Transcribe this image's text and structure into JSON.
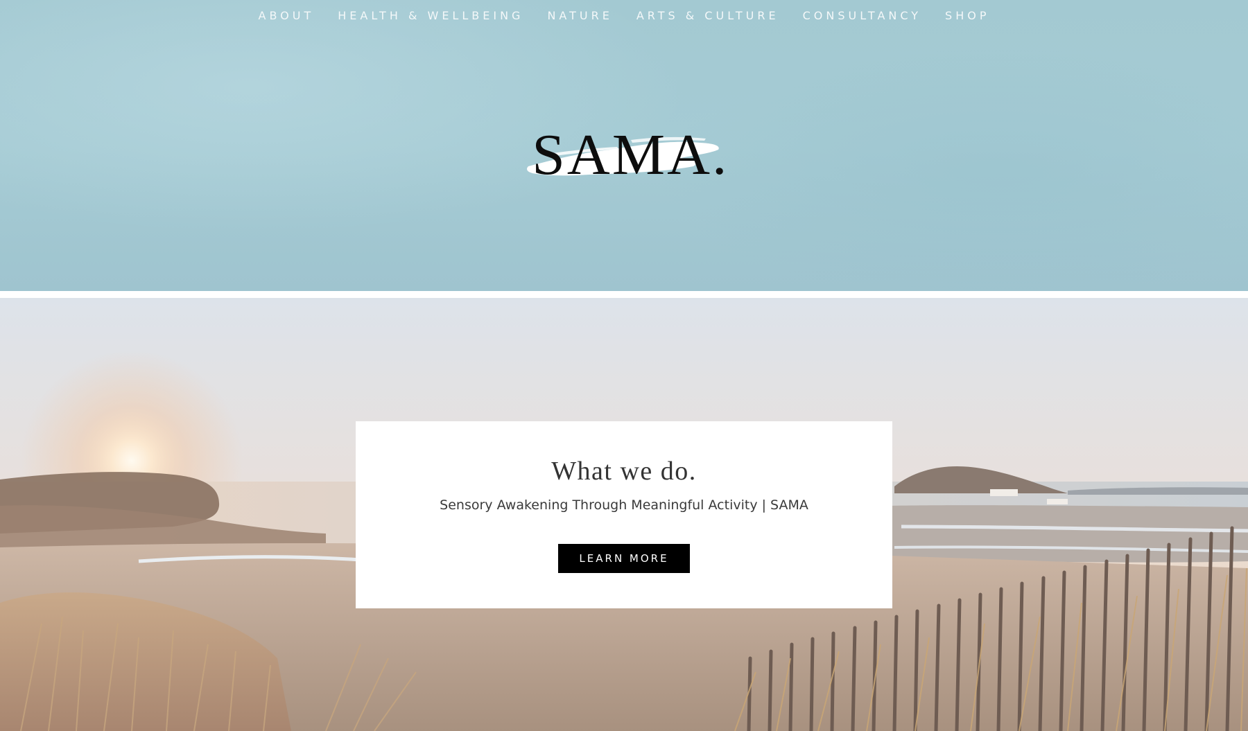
{
  "nav": {
    "items": [
      {
        "label": "ABOUT"
      },
      {
        "label": "HEALTH & WELLBEING"
      },
      {
        "label": "NATURE"
      },
      {
        "label": "ARTS & CULTURE"
      },
      {
        "label": "CONSULTANCY"
      },
      {
        "label": "SHOP"
      }
    ]
  },
  "logo": {
    "text": "SAMA."
  },
  "hero": {
    "title": "What we do.",
    "subtitle": "Sensory Awakening Through Meaningful Activity | SAMA",
    "button_label": "LEARN MORE"
  },
  "colors": {
    "header_bg": "#a3c9d2",
    "button_bg": "#000000",
    "logo_brush": "#ffffff"
  }
}
